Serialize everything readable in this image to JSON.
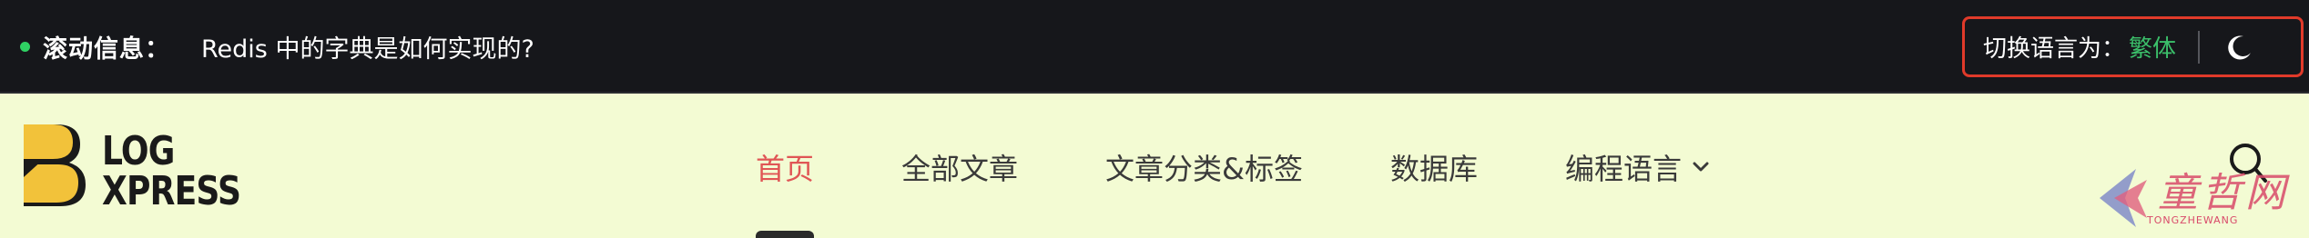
{
  "topbar": {
    "ticker_label": "滚动信息：",
    "ticker_message": "Redis 中的字典是如何实现的?",
    "language_label": "切换语言为：",
    "language_value": "繁体"
  },
  "logo": {
    "line1": "LOG",
    "line2": "XPRESS"
  },
  "nav": {
    "items": [
      {
        "label": "首页",
        "active": true
      },
      {
        "label": "全部文章"
      },
      {
        "label": "文章分类&标签"
      },
      {
        "label": "数据库"
      },
      {
        "label": "编程语言",
        "has_dropdown": true
      }
    ]
  },
  "watermark": {
    "text": "童哲网",
    "sub": "TONGZHEWANG"
  },
  "colors": {
    "topbar_bg": "#16171b",
    "header_bg": "#f3fbd3",
    "active_nav": "#e05555",
    "lang_value": "#3bbf6a",
    "highlight_border": "#e03a2a",
    "logo_yellow": "#f2c23a"
  },
  "icons": {
    "ticker_dot": "status-dot-icon",
    "theme_toggle": "moon-icon",
    "dropdown": "chevron-down-icon",
    "search": "search-icon"
  }
}
